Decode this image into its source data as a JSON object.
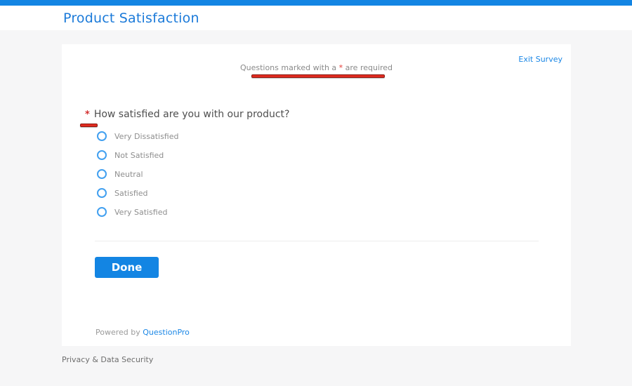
{
  "header": {
    "title": "Product Satisfaction"
  },
  "survey": {
    "exit_label": "Exit Survey",
    "required_note": {
      "prefix": "Questions marked with a ",
      "asterisk": "*",
      "suffix": " are required"
    },
    "question": {
      "asterisk": "*",
      "text": "How satisfied are you with our product?",
      "options": [
        "Very Dissatisfied",
        "Not Satisfied",
        "Neutral",
        "Satisfied",
        "Very Satisfied"
      ]
    },
    "done_label": "Done",
    "powered_by": {
      "prefix": "Powered by ",
      "brand": "QuestionPro"
    }
  },
  "footer": {
    "privacy_label": "Privacy & Data Security"
  },
  "colors": {
    "accent_blue": "#1385e3",
    "link_blue": "#1b87e6",
    "annotation_red": "#e02b20",
    "annotation_border": "#8b1a12"
  }
}
